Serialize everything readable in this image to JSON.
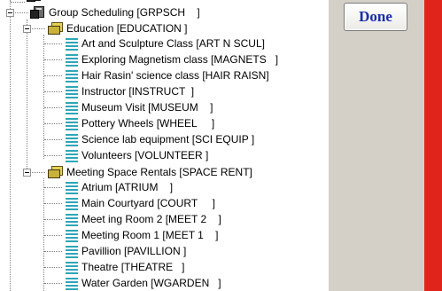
{
  "toolbar": {
    "done_label": "Done"
  },
  "tree": {
    "top_partial_label": "",
    "root": {
      "label": "Group Scheduling [GRPSCH    ]"
    },
    "groups": [
      {
        "label": "Education [EDUCATION ]",
        "items": [
          "Art and Sculpture Class [ART N SCUL]",
          "Exploring Magnetism class [MAGNETS   ]",
          "Hair Rasin' science class [HAIR RAISN]",
          "Instructor [INSTRUCT  ]",
          "Museum Visit [MUSEUM    ]",
          "Pottery Wheels [WHEEL     ]",
          "Science lab equipment [SCI EQUIP ]",
          "Volunteers [VOLUNTEER ]"
        ]
      },
      {
        "label": "Meeting Space Rentals [SPACE RENT]",
        "items": [
          "Atrium [ATRIUM    ]",
          "Main Courtyard [COURT     ]",
          "Meet ing Room 2 [MEET 2    ]",
          "Meeting Room 1 [MEET 1    ]",
          "Pavillion [PAVILLION ]",
          "Theatre [THEATRE   ]",
          "Water Garden [WGARDEN   ]"
        ]
      }
    ]
  }
}
